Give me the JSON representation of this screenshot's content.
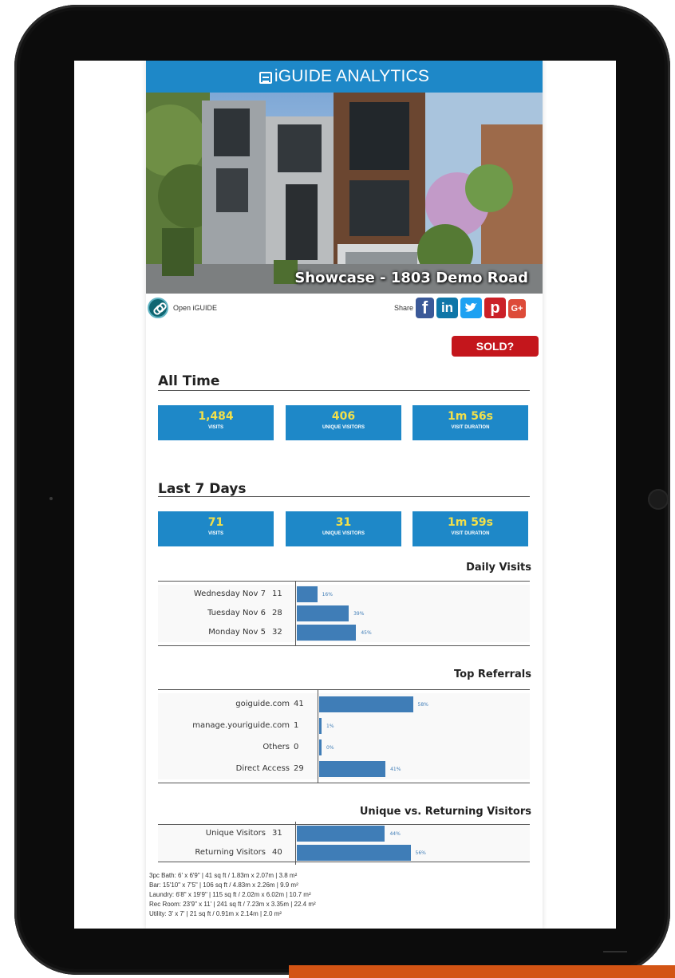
{
  "app": {
    "title": "iGUIDE ANALYTICS",
    "hero_caption": "Showcase - 1803 Demo Road"
  },
  "actions": {
    "open_iguide": "Open iGUIDE",
    "share": "Share",
    "social": [
      {
        "name": "facebook-icon",
        "glyph": "f",
        "color": "#3b5998"
      },
      {
        "name": "linkedin-icon",
        "glyph": "in",
        "color": "#0e76a8"
      },
      {
        "name": "twitter-icon",
        "glyph": "🐦",
        "color": "#1da1f2"
      },
      {
        "name": "pinterest-icon",
        "glyph": "p",
        "color": "#cb2027"
      },
      {
        "name": "google-plus-icon",
        "glyph": "G+",
        "color": "#dd4b39"
      }
    ],
    "sold": "SOLD?"
  },
  "all_time": {
    "title": "All Time",
    "stats": [
      {
        "value": "1,484",
        "label": "VISITS"
      },
      {
        "value": "406",
        "label": "UNIQUE VISITORS"
      },
      {
        "value": "1m 56s",
        "label": "VISIT DURATION"
      }
    ]
  },
  "last_7_days": {
    "title": "Last 7 Days",
    "stats": [
      {
        "value": "71",
        "label": "VISITS"
      },
      {
        "value": "31",
        "label": "UNIQUE VISITORS"
      },
      {
        "value": "1m 59s",
        "label": "VISIT DURATION"
      }
    ]
  },
  "chart_data": [
    {
      "type": "bar",
      "title": "Daily Visits",
      "categories": [
        "Wednesday Nov 7",
        "Tuesday Nov 6",
        "Monday Nov 5"
      ],
      "values": [
        11,
        28,
        32
      ],
      "percent_labels": [
        "16%",
        "39%",
        "45%"
      ]
    },
    {
      "type": "bar",
      "title": "Top Referrals",
      "categories": [
        "goiguide.com",
        "manage.youriguide.com",
        "Others",
        "Direct Access"
      ],
      "values": [
        41,
        1,
        0,
        29
      ],
      "percent_labels": [
        "58%",
        "1%",
        "0%",
        "41%"
      ]
    },
    {
      "type": "bar",
      "title": "Unique vs. Returning Visitors",
      "categories": [
        "Unique Visitors",
        "Returning Visitors"
      ],
      "values": [
        31,
        40
      ],
      "percent_labels": [
        "44%",
        "56%"
      ]
    }
  ],
  "rooms": [
    "3pc Bath: 6' x 6'9\" | 41 sq ft  /  1.83m x 2.07m | 3.8 m²",
    "Bar: 15'10\" x 7'5\" | 106 sq ft  /  4.83m x 2.26m | 9.9 m²",
    "Laundry: 6'8\" x 19'9\" | 115 sq ft  /  2.02m x 6.02m | 10.7 m²",
    "Rec Room: 23'9\" x 11' | 241 sq ft  /  7.23m x 3.35m | 22.4 m²",
    "Utility: 3' x 7' | 21 sq ft  /  0.91m x 2.14m | 2.0 m²"
  ],
  "colors": {
    "brand": "#1e88c8",
    "stat_value": "#f2e04a",
    "bar": "#3f7db7",
    "sold": "#c4161c"
  }
}
